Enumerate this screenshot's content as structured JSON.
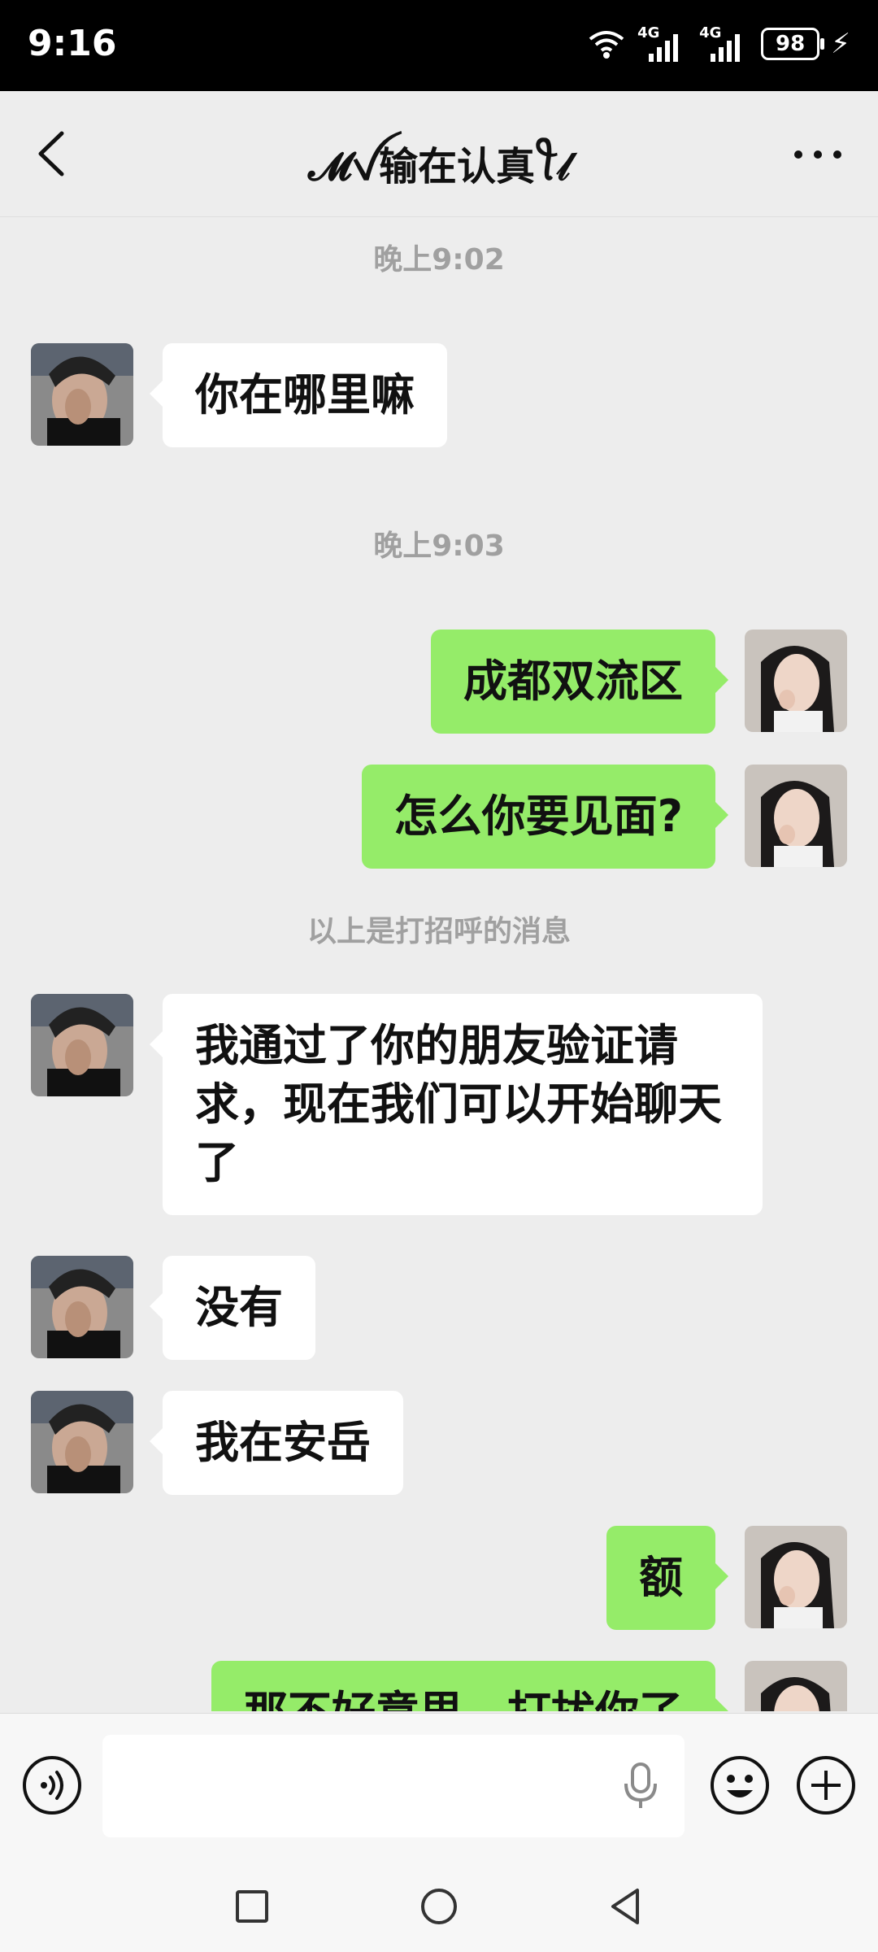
{
  "status_bar": {
    "time": "9:16",
    "signal1_label": "4G",
    "signal2_label": "4G",
    "battery": "98"
  },
  "header": {
    "title": "𝓜ꪜ输在认真ꪻ𝓁",
    "back_icon": "chevron-left-icon",
    "more_icon": "more-dots-icon"
  },
  "colors": {
    "incoming_bubble": "#ffffff",
    "outgoing_bubble": "#95ec69",
    "chat_background": "#ededed",
    "timestamp_text": "#a0a0a0"
  },
  "chat": {
    "timestamps": [
      "晚上9:02",
      "晚上9:03"
    ],
    "system_notice": "以上是打招呼的消息",
    "messages": [
      {
        "side": "in",
        "text": "你在哪里嘛"
      },
      {
        "side": "out",
        "text": "成都双流区"
      },
      {
        "side": "out",
        "text": "怎么你要见面?"
      },
      {
        "side": "in",
        "text": "我通过了你的朋友验证请求，现在我们可以开始聊天了"
      },
      {
        "side": "in",
        "text": "没有"
      },
      {
        "side": "in",
        "text": "我在安岳"
      },
      {
        "side": "out",
        "text": "额"
      },
      {
        "side": "out",
        "text": "那不好意思，打扰你了"
      }
    ]
  },
  "input_bar": {
    "voice_icon": "voice-icon",
    "mic_icon": "microphone-icon",
    "emoji_icon": "emoji-icon",
    "plus_icon": "plus-icon"
  },
  "nav_bar": {
    "recents_icon": "square-icon",
    "home_icon": "circle-icon",
    "back_icon": "triangle-back-icon"
  }
}
